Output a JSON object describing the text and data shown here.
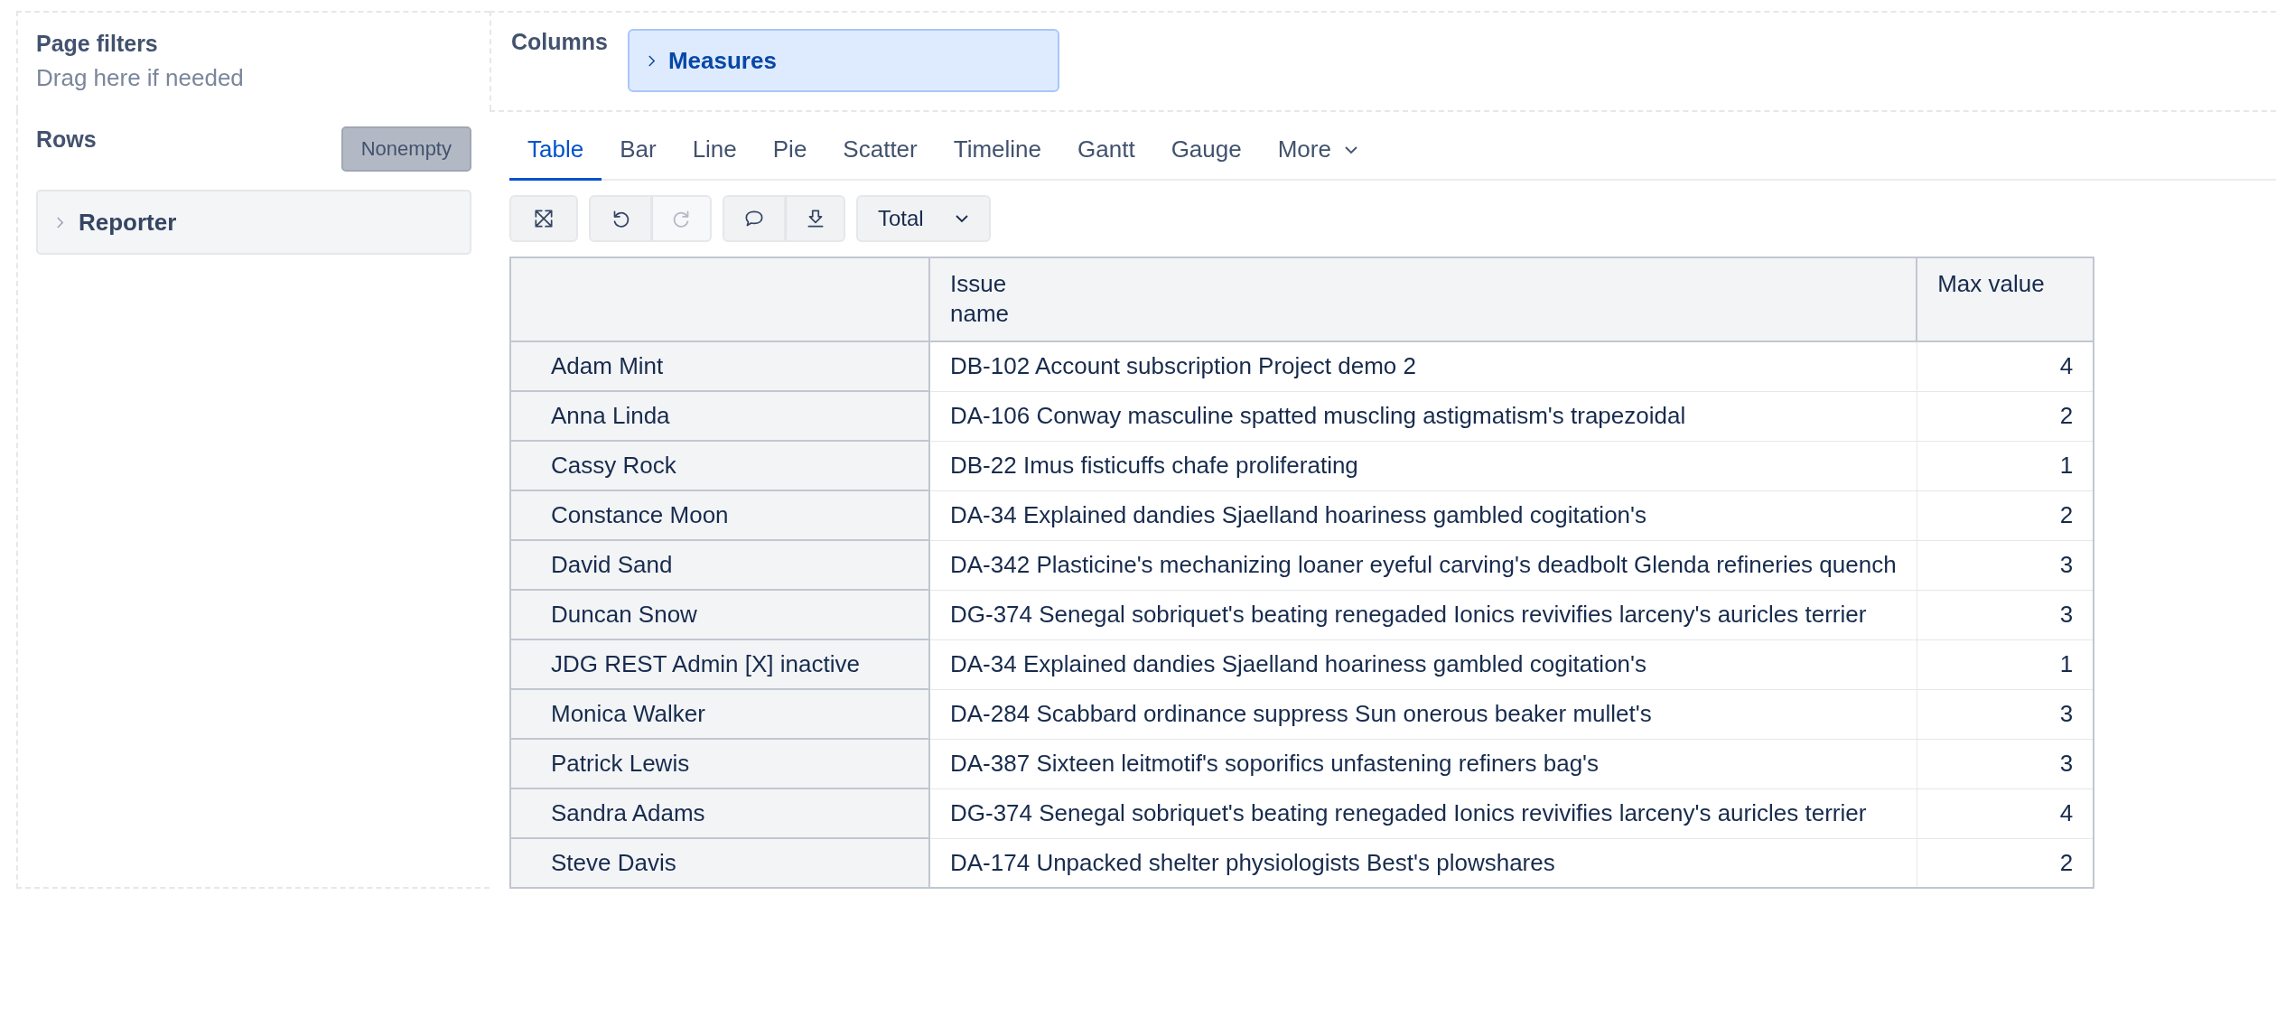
{
  "page_filters": {
    "title": "Page filters",
    "hint": "Drag here if needed"
  },
  "columns": {
    "title": "Columns",
    "items": [
      {
        "label": "Measures"
      }
    ]
  },
  "rows": {
    "title": "Rows",
    "nonempty_button": "Nonempty",
    "items": [
      {
        "label": "Reporter"
      }
    ]
  },
  "tabs": [
    {
      "label": "Table",
      "selected": true
    },
    {
      "label": "Bar",
      "selected": false
    },
    {
      "label": "Line",
      "selected": false
    },
    {
      "label": "Pie",
      "selected": false
    },
    {
      "label": "Scatter",
      "selected": false
    },
    {
      "label": "Timeline",
      "selected": false
    },
    {
      "label": "Gantt",
      "selected": false
    },
    {
      "label": "Gauge",
      "selected": false
    },
    {
      "label": "More",
      "selected": false,
      "kind": "dropdown"
    }
  ],
  "toolbar": {
    "groups": [
      [
        {
          "kind": "fullscreen",
          "disabled": false
        }
      ],
      [
        {
          "kind": "undo",
          "disabled": false
        },
        {
          "kind": "redo",
          "disabled": true
        }
      ],
      [
        {
          "kind": "comment",
          "disabled": false
        },
        {
          "kind": "download",
          "disabled": false
        }
      ]
    ],
    "total_dropdown": "Total"
  },
  "table": {
    "columns": [
      "",
      "Issue\nname",
      "Max value"
    ],
    "rows": [
      {
        "reporter": "Adam Mint",
        "issue": "DB-102 Account subscription Project demo 2",
        "value": "4"
      },
      {
        "reporter": "Anna Linda",
        "issue": "DA-106 Conway masculine spatted muscling astigmatism's trapezoidal",
        "value": "2"
      },
      {
        "reporter": "Cassy Rock",
        "issue": "DB-22 Imus fisticuffs chafe proliferating",
        "value": "1"
      },
      {
        "reporter": "Constance Moon",
        "issue": "DA-34 Explained dandies Sjaelland hoariness gambled cogitation's",
        "value": "2"
      },
      {
        "reporter": "David Sand",
        "issue": "DA-342 Plasticine's mechanizing loaner eyeful carving's deadbolt Glenda refineries quench",
        "value": "3"
      },
      {
        "reporter": "Duncan Snow",
        "issue": "DG-374 Senegal sobriquet's beating renegaded Ionics revivifies larceny's auricles terrier",
        "value": "3"
      },
      {
        "reporter": "JDG REST Admin [X] inactive",
        "issue": "DA-34 Explained dandies Sjaelland hoariness gambled cogitation's",
        "value": "1"
      },
      {
        "reporter": "Monica Walker",
        "issue": "DA-284 Scabbard ordinance suppress Sun onerous beaker mullet's",
        "value": "3"
      },
      {
        "reporter": "Patrick Lewis",
        "issue": "DA-387 Sixteen leitmotif's soporifics unfastening refiners bag's",
        "value": "3"
      },
      {
        "reporter": "Sandra Adams",
        "issue": "DG-374 Senegal sobriquet's beating renegaded Ionics revivifies larceny's auricles terrier",
        "value": "4"
      },
      {
        "reporter": "Steve Davis",
        "issue": "DA-174 Unpacked shelter physiologists Best's plowshares",
        "value": "2"
      }
    ]
  }
}
